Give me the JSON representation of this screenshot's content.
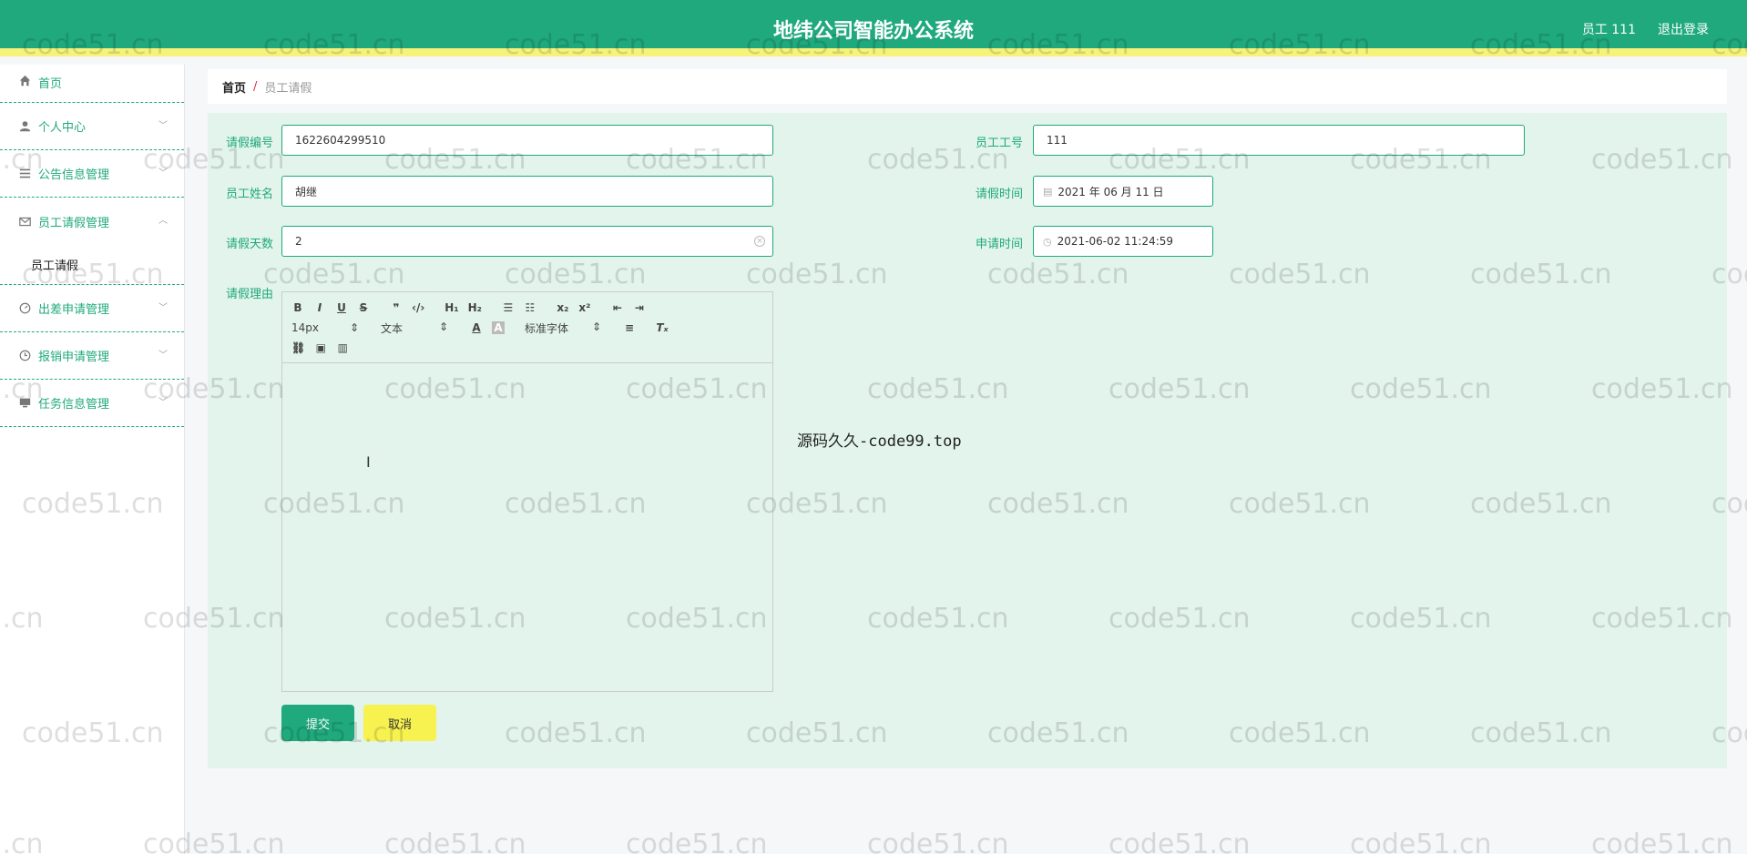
{
  "header": {
    "title": "地纬公司智能办公系统",
    "user": "员工 111",
    "logout": "退出登录"
  },
  "sidebar": {
    "items": [
      {
        "label": "首页",
        "icon": "home-icon"
      },
      {
        "label": "个人中心",
        "icon": "user-icon"
      },
      {
        "label": "公告信息管理",
        "icon": "list-icon"
      },
      {
        "label": "员工请假管理",
        "icon": "mail-icon"
      },
      {
        "label": "出差申请管理",
        "icon": "gauge-icon"
      },
      {
        "label": "报销申请管理",
        "icon": "clock-icon"
      },
      {
        "label": "任务信息管理",
        "icon": "monitor-icon"
      }
    ],
    "submenu": {
      "label": "员工请假"
    }
  },
  "breadcrumb": {
    "home": "首页",
    "sep": "/",
    "current": "员工请假"
  },
  "form": {
    "leave_no": {
      "label": "请假编号",
      "value": "1622604299510"
    },
    "emp_no": {
      "label": "员工工号",
      "value": "111"
    },
    "emp_name": {
      "label": "员工姓名",
      "value": "胡继"
    },
    "leave_time": {
      "label": "请假时间",
      "value": "2021 年 06 月 11 日"
    },
    "leave_days": {
      "label": "请假天数",
      "value": "2"
    },
    "apply_time": {
      "label": "申请时间",
      "value": "2021-06-02 11:24:59"
    },
    "reason": {
      "label": "请假理由"
    },
    "submit": "提交",
    "cancel": "取消"
  },
  "editor": {
    "font_size": "14px",
    "block_type": "文本",
    "font_family": "标准字体"
  },
  "overlay_text": "源码久久-code99.top",
  "watermark": "code51.cn",
  "colors": {
    "primary": "#1fa97c",
    "accent_yellow": "#f7f27a",
    "panel_bg": "#e2f4ec"
  }
}
